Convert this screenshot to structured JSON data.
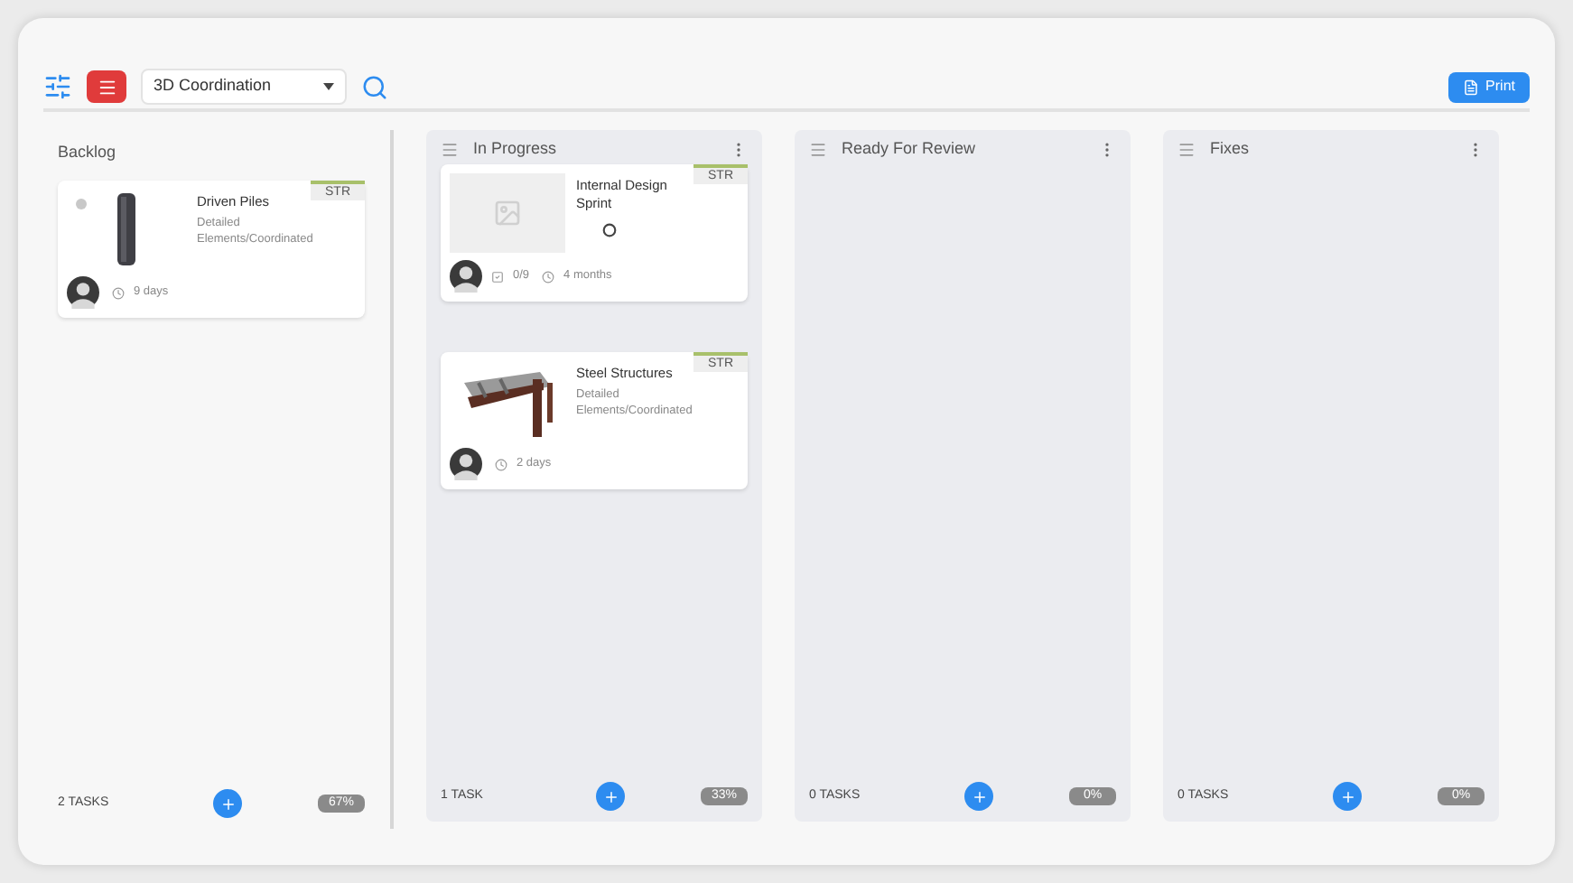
{
  "toolbar": {
    "project": "3D Coordination",
    "print_label": "Print"
  },
  "columns": [
    {
      "kind": "backlog",
      "title": "Backlog",
      "tasks_label": "2 TASKS",
      "percent": "67%",
      "cards": [
        {
          "kind": "pile",
          "title": "Driven Piles",
          "subtitle": "Detailed Elements/Coordinated",
          "tag": "STR",
          "duration": "9 days"
        }
      ]
    },
    {
      "kind": "lane",
      "title": "In Progress",
      "tasks_label": "1 TASK",
      "percent": "33%",
      "cards": [
        {
          "kind": "placeholder",
          "title": "Internal Design Sprint",
          "tag": "STR",
          "checklist": "0/9",
          "duration": "4 months"
        },
        {
          "kind": "steel",
          "title": "Steel Structures",
          "subtitle": "Detailed Elements/Coordinated",
          "tag": "STR",
          "duration": "2 days"
        }
      ]
    },
    {
      "kind": "lane",
      "title": "Ready For Review",
      "tasks_label": "0 TASKS",
      "percent": "0%"
    },
    {
      "kind": "lane",
      "title": "Fixes",
      "tasks_label": "0 TASKS",
      "percent": "0%"
    }
  ]
}
